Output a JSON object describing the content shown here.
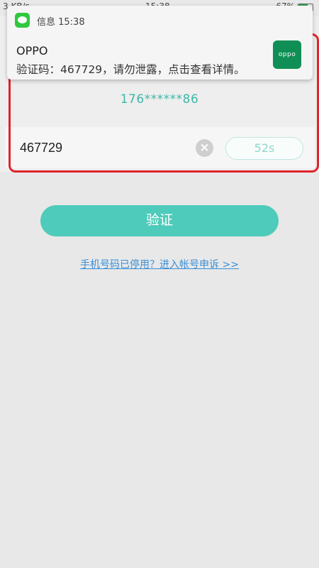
{
  "statusbar": {
    "left_text": "3 KB/s",
    "time": "15:38",
    "battery": "67%",
    "battery_level": 0.67
  },
  "notification": {
    "app_label": "信息 15:38",
    "sender": "OPPO",
    "body": "验证码：467729，请勿泄露，点击查看详情。",
    "logo_text": "oppo"
  },
  "verify": {
    "masked_phone": "176******86",
    "code_value": "467729",
    "clear_icon": "×",
    "countdown": "52s",
    "button_label": "验证",
    "appeal_link": "手机号码已停用？进入帐号申诉 >>"
  },
  "colors": {
    "accent": "#4ecbba",
    "highlight": "#e0242b",
    "link": "#3a8fd6"
  }
}
